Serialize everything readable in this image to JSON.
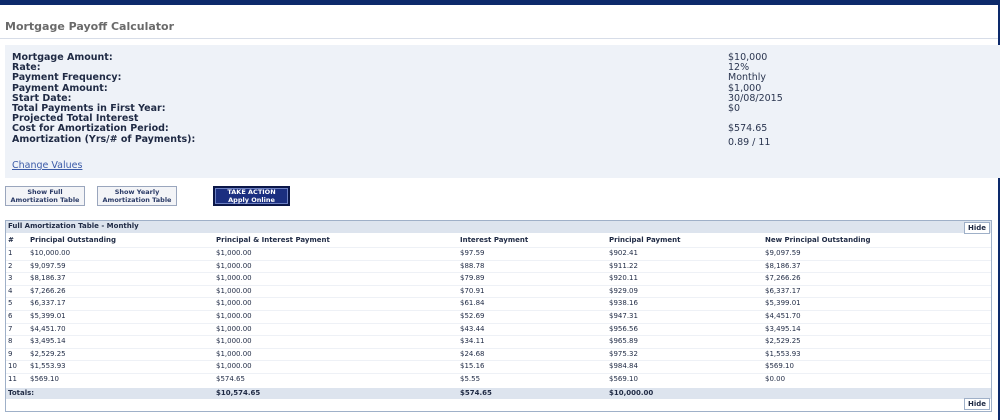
{
  "page": {
    "title": "Mortgage Payoff Calculator"
  },
  "summary": {
    "labels": {
      "mortgage_amount": "Mortgage Amount:",
      "rate": "Rate:",
      "payment_frequency": "Payment Frequency:",
      "payment_amount": "Payment Amount:",
      "start_date": "Start Date:",
      "total_payments_first_year": "Total Payments in First Year:",
      "projected_interest_line1": "Projected Total Interest",
      "projected_interest_line2": "Cost for Amortization Period:",
      "amortization": "Amortization (Yrs/# of Payments):"
    },
    "values": {
      "mortgage_amount": "$10,000",
      "rate": "12%",
      "payment_frequency": "Monthly",
      "payment_amount": "$1,000",
      "start_date": "30/08/2015",
      "total_payments_first_year": "$0",
      "projected_interest": "$574.65",
      "amortization": "0.89 / 11"
    },
    "change_link": "Change Values"
  },
  "buttons": {
    "full_line1": "Show Full",
    "full_line2": "Amortization Table",
    "yearly_line1": "Show Yearly",
    "yearly_line2": "Amortization Table",
    "apply_line1": "TAKE ACTION",
    "apply_line2": "Apply Online"
  },
  "table": {
    "title": "Full Amortization Table - Monthly",
    "hide_label": "Hide",
    "columns": [
      "#",
      "Principal Outstanding",
      "Principal & Interest Payment",
      "Interest Payment",
      "Principal Payment",
      "New Principal Outstanding"
    ],
    "rows": [
      [
        "1",
        "$10,000.00",
        "$1,000.00",
        "$97.59",
        "$902.41",
        "$9,097.59"
      ],
      [
        "2",
        "$9,097.59",
        "$1,000.00",
        "$88.78",
        "$911.22",
        "$8,186.37"
      ],
      [
        "3",
        "$8,186.37",
        "$1,000.00",
        "$79.89",
        "$920.11",
        "$7,266.26"
      ],
      [
        "4",
        "$7,266.26",
        "$1,000.00",
        "$70.91",
        "$929.09",
        "$6,337.17"
      ],
      [
        "5",
        "$6,337.17",
        "$1,000.00",
        "$61.84",
        "$938.16",
        "$5,399.01"
      ],
      [
        "6",
        "$5,399.01",
        "$1,000.00",
        "$52.69",
        "$947.31",
        "$4,451.70"
      ],
      [
        "7",
        "$4,451.70",
        "$1,000.00",
        "$43.44",
        "$956.56",
        "$3,495.14"
      ],
      [
        "8",
        "$3,495.14",
        "$1,000.00",
        "$34.11",
        "$965.89",
        "$2,529.25"
      ],
      [
        "9",
        "$2,529.25",
        "$1,000.00",
        "$24.68",
        "$975.32",
        "$1,553.93"
      ],
      [
        "10",
        "$1,553.93",
        "$1,000.00",
        "$15.16",
        "$984.84",
        "$569.10"
      ],
      [
        "11",
        "$569.10",
        "$574.65",
        "$5.55",
        "$569.10",
        "$0.00"
      ]
    ],
    "totals": {
      "label": "Totals:",
      "pi": "$10,574.65",
      "interest": "$574.65",
      "principal": "$10,000.00"
    }
  }
}
